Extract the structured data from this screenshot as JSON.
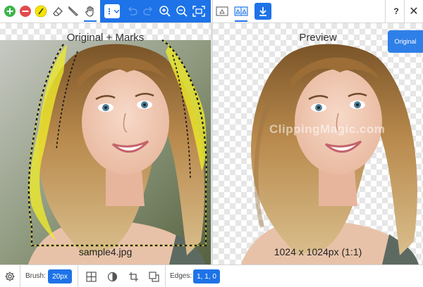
{
  "toolbar": {
    "tools": [
      "add-marker",
      "remove-marker",
      "hair-brush",
      "eraser",
      "scalpel",
      "pan-hand"
    ],
    "selected_tool": "pan-hand",
    "view_dropdown_symbol": "⋮",
    "view_panel_buttons": [
      "single-view",
      "side-by-side-view"
    ],
    "download_symbol": "⭳",
    "help_label": "?",
    "close_label": "✕"
  },
  "left_panel": {
    "title": "Original + Marks",
    "filename": "sample4.jpg"
  },
  "right_panel": {
    "title": "Preview",
    "dimensions": "1024 x 1024px (1:1)",
    "original_button": "Original",
    "watermark": "ClippingMagic.com"
  },
  "bottom": {
    "brush_label": "Brush:",
    "brush_value": "20px",
    "edges_label": "Edges:",
    "edges_value": "1, 1, 0"
  },
  "colors": {
    "accent": "#1e73e8",
    "keep_marker": "#3cb54a",
    "remove_marker": "#e24b4b",
    "hair_marker": "#f5e400",
    "mark_highlight": "#f0ec2a"
  }
}
